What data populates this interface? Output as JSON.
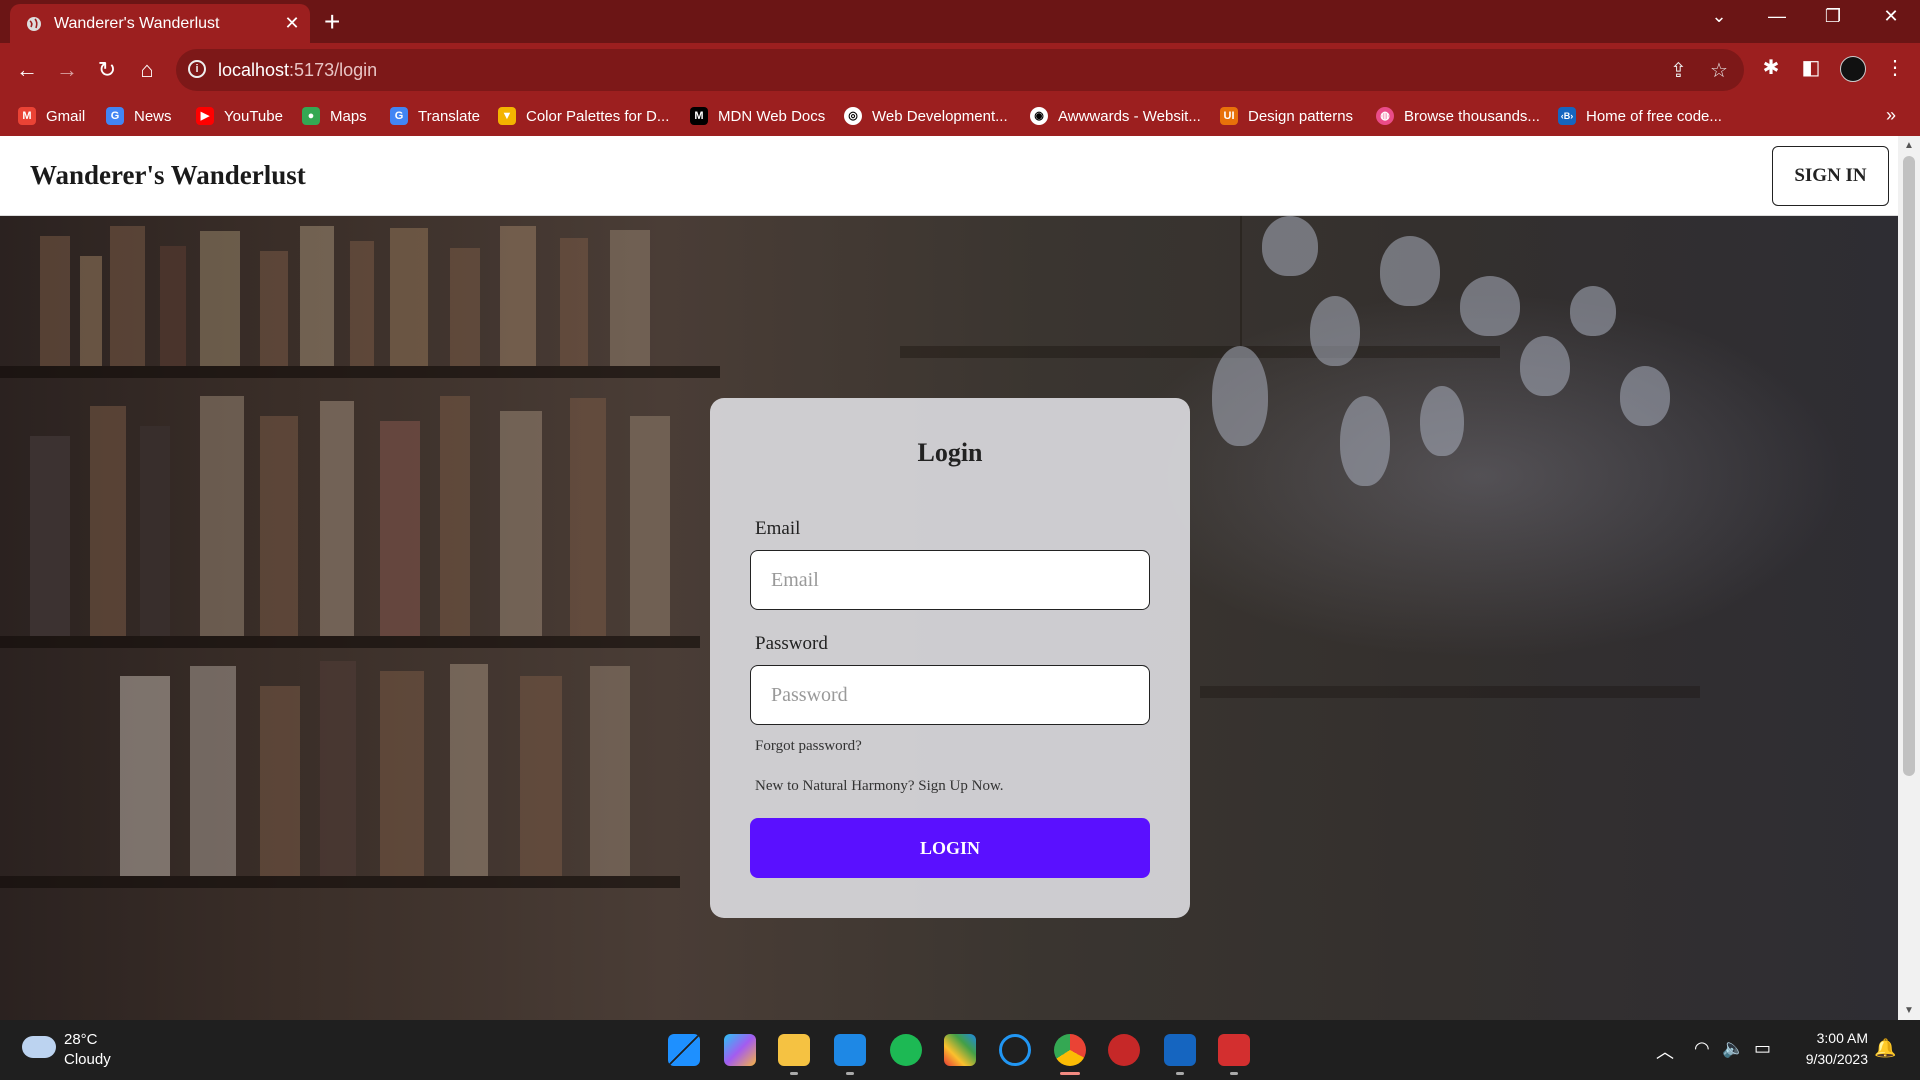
{
  "browser": {
    "tab_title": "Wanderer's Wanderlust",
    "url_host": "localhost",
    "url_path": ":5173/login",
    "bookmarks": [
      {
        "label": "Gmail",
        "color": "#ea4335"
      },
      {
        "label": "News",
        "color": "#4285f4"
      },
      {
        "label": "YouTube",
        "color": "#ff0000"
      },
      {
        "label": "Maps",
        "color": "#34a853"
      },
      {
        "label": "Translate",
        "color": "#4285f4"
      },
      {
        "label": "Color Palettes for D...",
        "color": "#f4b400"
      },
      {
        "label": "MDN Web Docs",
        "color": "#000000"
      },
      {
        "label": "Web Development...",
        "color": "#ffffff"
      },
      {
        "label": "Awwwards - Websit...",
        "color": "#ffffff"
      },
      {
        "label": "Design patterns",
        "color": "#e8710a"
      },
      {
        "label": "Browse thousands...",
        "color": "#ea4c89"
      },
      {
        "label": "Home of free code...",
        "color": "#1565c0"
      }
    ]
  },
  "header": {
    "brand": "Wanderer's Wanderlust",
    "signin_label": "SIGN IN"
  },
  "login": {
    "title": "Login",
    "email_label": "Email",
    "email_placeholder": "Email",
    "password_label": "Password",
    "password_placeholder": "Password",
    "forgot_password": "Forgot password?",
    "signup_text": "New to Natural Harmony? Sign Up Now.",
    "login_button": "LOGIN",
    "button_color": "#5a10ff"
  },
  "taskbar": {
    "weather_temp": "28°C",
    "weather_desc": "Cloudy",
    "time": "3:00 AM",
    "date": "9/30/2023"
  }
}
